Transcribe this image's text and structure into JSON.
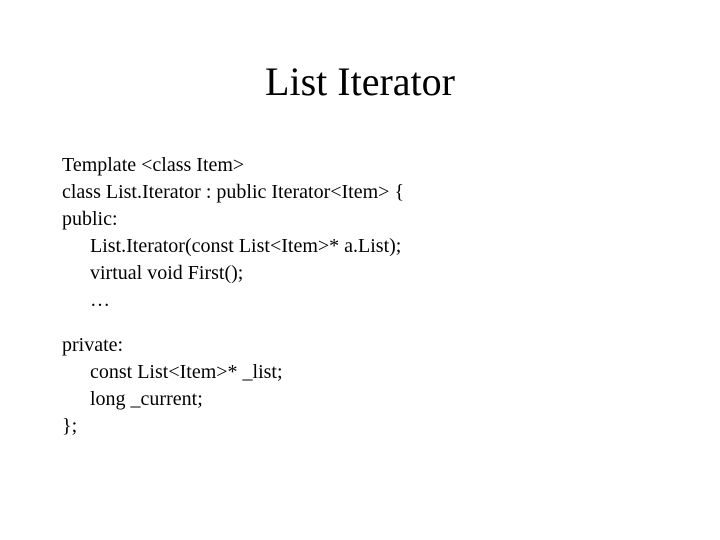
{
  "title": "List Iterator",
  "lines": {
    "l1": "Template <class Item>",
    "l2": "class List.Iterator : public Iterator<Item> {",
    "l3": "public:",
    "l4": "List.Iterator(const List<Item>* a.List);",
    "l5": "virtual void First();",
    "l6": "…",
    "l7": "private:",
    "l8": "const List<Item>* _list;",
    "l9": "long _current;",
    "l10": "};"
  }
}
